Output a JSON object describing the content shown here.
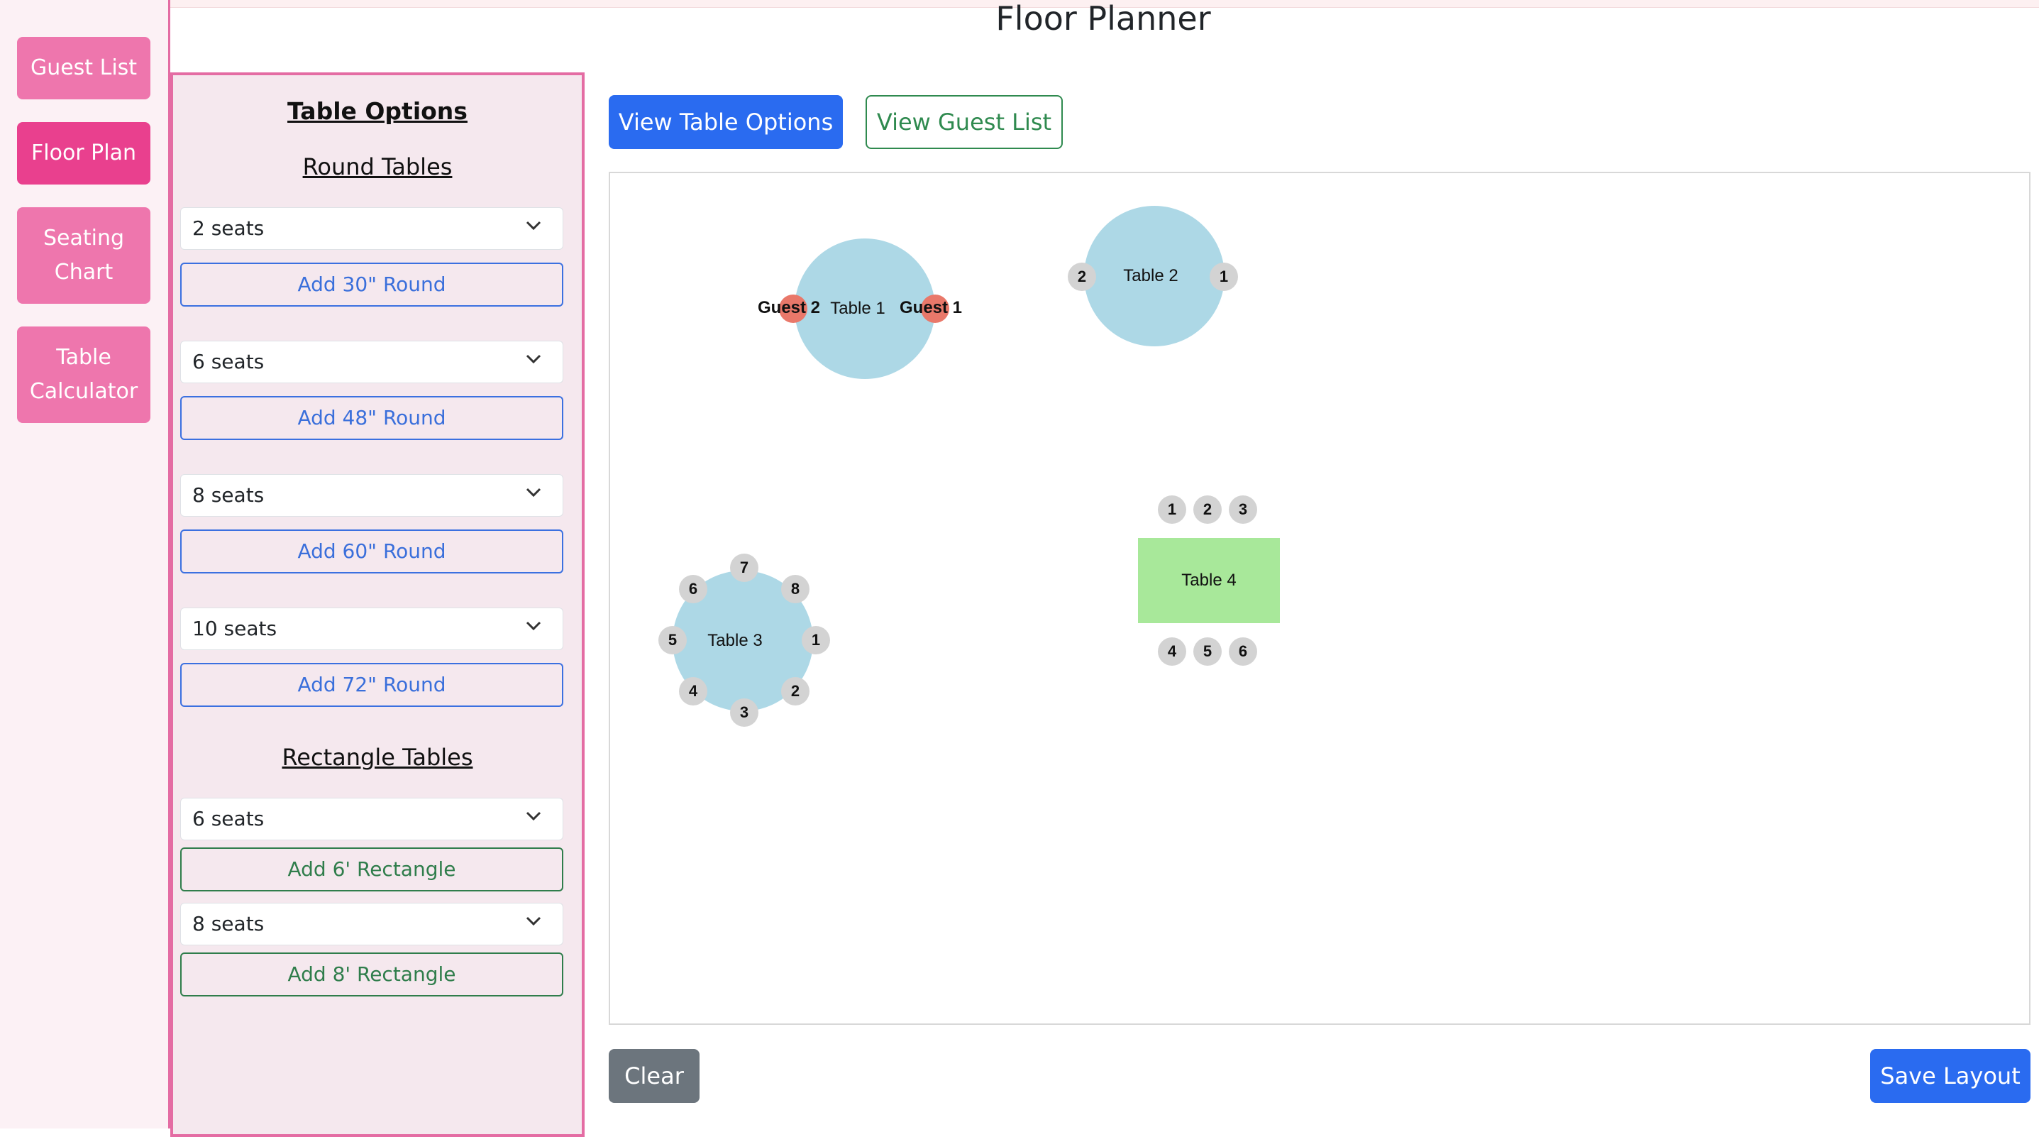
{
  "nav": {
    "items": [
      {
        "label": "Guest List",
        "active": false
      },
      {
        "label": "Floor Plan",
        "active": true
      },
      {
        "label": "Seating Chart",
        "active": false
      },
      {
        "label": "Table Calculator",
        "active": false
      }
    ]
  },
  "page": {
    "title": "Floor Planner"
  },
  "sidebar": {
    "heading": "Table Options",
    "round_heading": "Round Tables",
    "rect_heading": "Rectangle Tables",
    "round": [
      {
        "seats": "2 seats",
        "button": "Add 30\" Round"
      },
      {
        "seats": "6 seats",
        "button": "Add 48\" Round"
      },
      {
        "seats": "8 seats",
        "button": "Add 60\" Round"
      },
      {
        "seats": "10 seats",
        "button": "Add 72\" Round"
      }
    ],
    "rect": [
      {
        "seats": "6 seats",
        "button": "Add 6' Rectangle"
      },
      {
        "seats": "8 seats",
        "button": "Add 8' Rectangle"
      }
    ]
  },
  "toolbar": {
    "table_options": "View Table Options",
    "guest_list": "View Guest List"
  },
  "floor": {
    "tables": [
      {
        "label": "Table 1",
        "seats": [
          {
            "label": "Guest 2",
            "assigned": true
          },
          {
            "label": "Guest 1",
            "assigned": true
          }
        ]
      },
      {
        "label": "Table 2",
        "seats": [
          "2",
          "1"
        ]
      },
      {
        "label": "Table 3",
        "seats": [
          "1",
          "2",
          "3",
          "4",
          "5",
          "6",
          "7",
          "8"
        ]
      },
      {
        "label": "Table 4",
        "seats": [
          "1",
          "2",
          "3",
          "4",
          "5",
          "6"
        ]
      }
    ]
  },
  "actions": {
    "clear": "Clear",
    "save": "Save Layout"
  },
  "colors": {
    "nav_button": "#ee76ad",
    "nav_active": "#e9408e",
    "primary": "#2a6bf0",
    "success": "#2f8a4f",
    "round_table": "#add8e6",
    "rect_table": "#a8e89a",
    "seat": "#d3d3d3",
    "seat_assigned": "#e9786a"
  },
  "icons": {
    "select_arrow": "chevron-down-icon"
  }
}
